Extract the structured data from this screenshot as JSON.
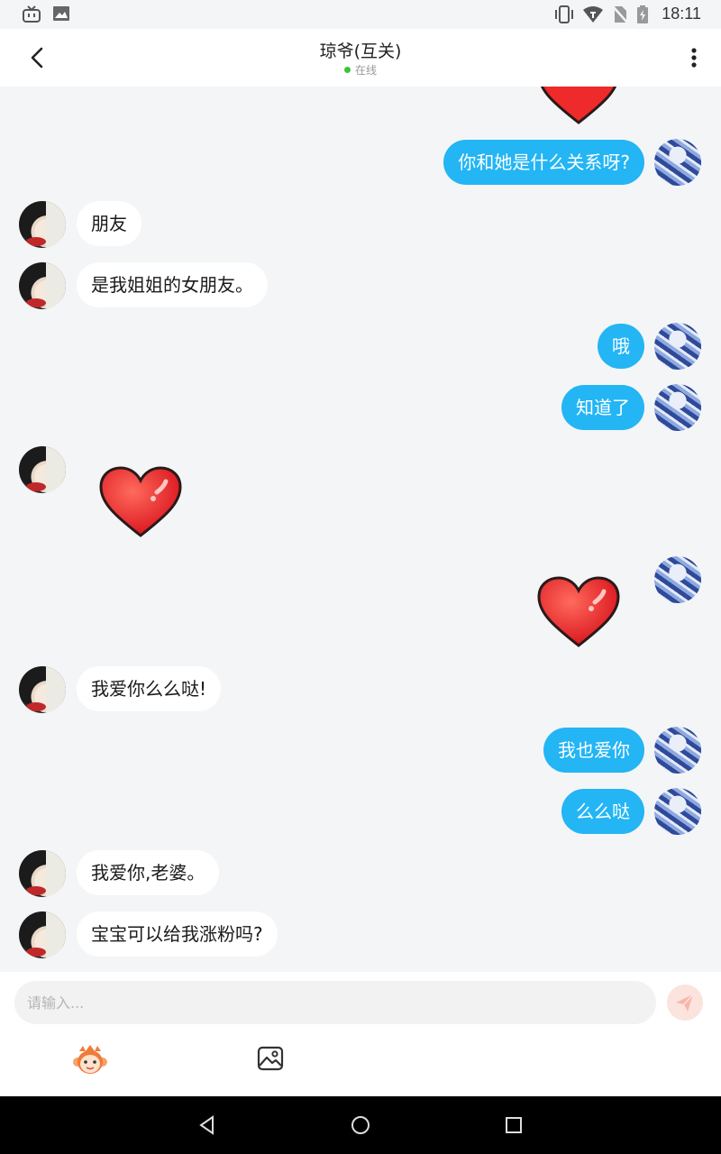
{
  "status_bar": {
    "time": "18:11"
  },
  "header": {
    "title": "琼爷(互关)",
    "status": "在线"
  },
  "messages": [
    {
      "from": "me",
      "type": "text",
      "text": "你和她是什么关系呀?"
    },
    {
      "from": "friend",
      "type": "text",
      "text": "朋友"
    },
    {
      "from": "friend",
      "type": "text",
      "text": "是我姐姐的女朋友。"
    },
    {
      "from": "me",
      "type": "text",
      "text": "哦"
    },
    {
      "from": "me",
      "type": "text",
      "text": "知道了"
    },
    {
      "from": "friend",
      "type": "sticker",
      "sticker": "heart"
    },
    {
      "from": "me",
      "type": "sticker",
      "sticker": "heart"
    },
    {
      "from": "friend",
      "type": "text",
      "text": "我爱你么么哒!"
    },
    {
      "from": "me",
      "type": "text",
      "text": "我也爱你"
    },
    {
      "from": "me",
      "type": "text",
      "text": "么么哒"
    },
    {
      "from": "friend",
      "type": "text",
      "text": "我爱你,老婆。"
    },
    {
      "from": "friend",
      "type": "text",
      "text": "宝宝可以给我涨粉吗?"
    }
  ],
  "composer": {
    "placeholder": "请输入...",
    "value": ""
  },
  "colors": {
    "my_bubble": "#23b5f4",
    "friend_bubble": "#ffffff",
    "online_dot": "#3cc23c",
    "send_button": "#fbe3de"
  },
  "icons": [
    "tv-icon",
    "image-icon",
    "vibrate-icon",
    "wifi-icon",
    "no-sim-icon",
    "battery-icon",
    "back-arrow-icon",
    "more-vertical-icon",
    "send-icon",
    "emoji-monkey-icon",
    "photo-icon",
    "nav-back-icon",
    "nav-home-icon",
    "nav-recents-icon"
  ]
}
